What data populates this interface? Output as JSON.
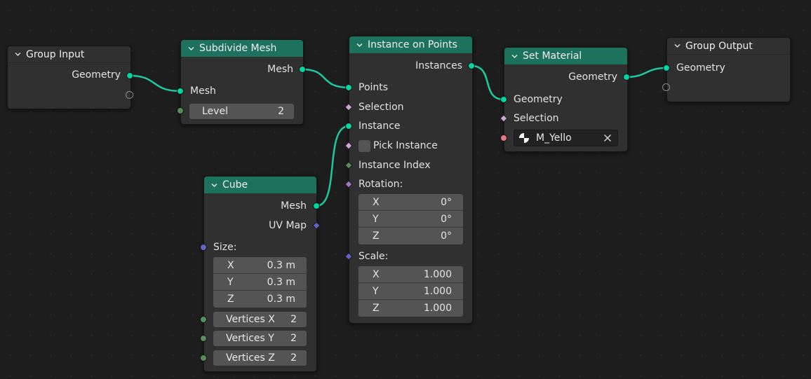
{
  "nodes": {
    "group_input": {
      "title": "Group Input",
      "outputs": [
        "Geometry"
      ]
    },
    "subdivide_mesh": {
      "title": "Subdivide Mesh",
      "output": "Mesh",
      "input": "Mesh",
      "level_label": "Level",
      "level_value": "2"
    },
    "cube": {
      "title": "Cube",
      "outputs": [
        "Mesh",
        "UV Map"
      ],
      "size_label": "Size:",
      "size": [
        {
          "axis": "X",
          "value": "0.3 m"
        },
        {
          "axis": "Y",
          "value": "0.3 m"
        },
        {
          "axis": "Z",
          "value": "0.3 m"
        }
      ],
      "vertices": [
        {
          "label": "Vertices X",
          "value": "2"
        },
        {
          "label": "Vertices Y",
          "value": "2"
        },
        {
          "label": "Vertices Z",
          "value": "2"
        }
      ]
    },
    "instance_on_points": {
      "title": "Instance on Points",
      "output": "Instances",
      "inputs": [
        "Points",
        "Selection",
        "Instance",
        "Pick Instance",
        "Instance Index"
      ],
      "rotation_label": "Rotation:",
      "rotation": [
        {
          "axis": "X",
          "value": "0°"
        },
        {
          "axis": "Y",
          "value": "0°"
        },
        {
          "axis": "Z",
          "value": "0°"
        }
      ],
      "scale_label": "Scale:",
      "scale": [
        {
          "axis": "X",
          "value": "1.000"
        },
        {
          "axis": "Y",
          "value": "1.000"
        },
        {
          "axis": "Z",
          "value": "1.000"
        }
      ]
    },
    "set_material": {
      "title": "Set Material",
      "output": "Geometry",
      "inputs": [
        "Geometry",
        "Selection"
      ],
      "material": "M_Yello"
    },
    "group_output": {
      "title": "Group Output",
      "inputs": [
        "Geometry"
      ]
    }
  },
  "colors": {
    "geometry_header": "#1d725e",
    "geometry_socket": "#00d6a3",
    "link": "#1fc8a0",
    "integer_socket": "#598c5c",
    "vector_socket": "#6363c7",
    "material_socket": "#eb7582",
    "boolean_socket": "#cca6d6"
  },
  "icons": [
    "chevron-down-icon",
    "material-sphere-icon",
    "close-icon"
  ]
}
